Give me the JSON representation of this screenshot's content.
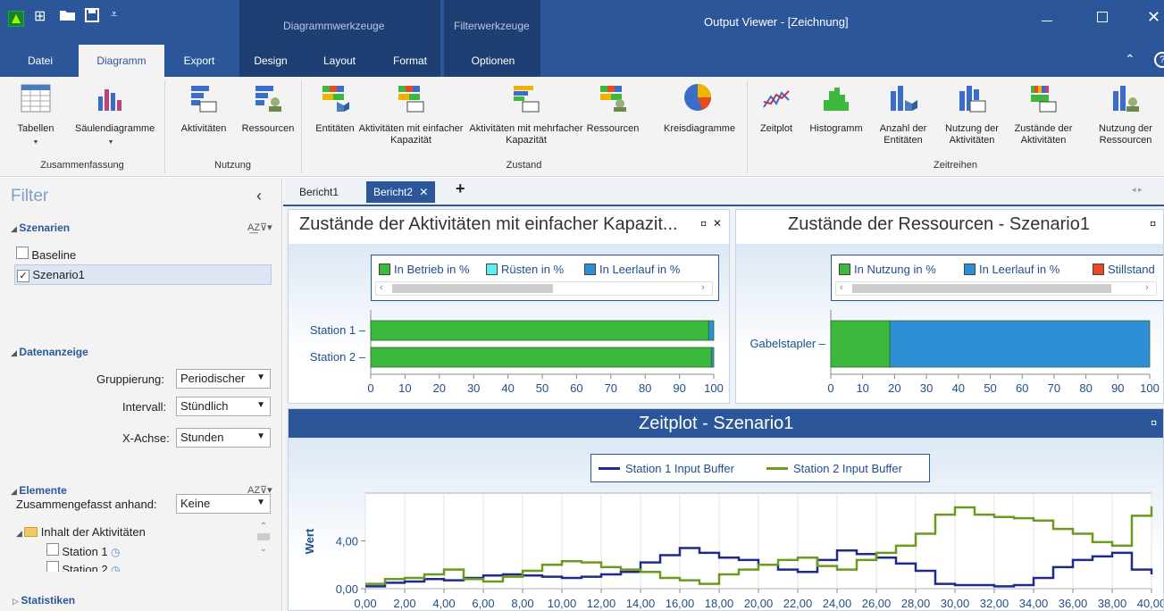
{
  "window": {
    "title": "Output Viewer - [Zeichnung]",
    "context_groups": [
      "Diagrammwerkzeuge",
      "Filterwerkzeuge"
    ]
  },
  "tabs": [
    "Datei",
    "Diagramm",
    "Export",
    "Design",
    "Layout",
    "Format",
    "Optionen"
  ],
  "ribbon": {
    "buttons": [
      {
        "label": "Tabellen",
        "dropdown": true
      },
      {
        "label": "Säulendiagramme",
        "dropdown": true
      },
      {
        "label": "Aktivitäten"
      },
      {
        "label": "Ressourcen"
      },
      {
        "label": "Entitäten"
      },
      {
        "label": "Aktivitäten mit einfacher Kapazität"
      },
      {
        "label": "Aktivitäten mit mehrfacher Kapazität"
      },
      {
        "label": "Ressourcen"
      },
      {
        "label": "Kreisdiagramme"
      },
      {
        "label": "Zeitplot"
      },
      {
        "label": "Histogramm"
      },
      {
        "label": "Anzahl der Entitäten"
      },
      {
        "label": "Nutzung der Aktivitäten"
      },
      {
        "label": "Zustände der Aktivitäten"
      },
      {
        "label": "Nutzung der Ressourcen"
      }
    ],
    "groups": [
      "Zusammenfassung",
      "Nutzung",
      "Zustand",
      "Zeitreihen"
    ]
  },
  "filter": {
    "title": "Filter",
    "collapse_glyph": "‹",
    "szenarien": {
      "label": "Szenarien",
      "items": [
        {
          "label": "Baseline",
          "checked": false
        },
        {
          "label": "Szenario1",
          "checked": true
        }
      ]
    },
    "datenanzeige": {
      "label": "Datenanzeige",
      "gruppierung_label": "Gruppierung:",
      "gruppierung_value": "Periodischer",
      "intervall_label": "Intervall:",
      "intervall_value": "Stündlich",
      "xachse_label": "X-Achse:",
      "xachse_value": "Stunden"
    },
    "elemente": {
      "label": "Elemente",
      "zusammengefasst_label": "Zusammengefasst anhand:",
      "zusammengefasst_value": "Keine",
      "folder": "Inhalt der Aktivitäten",
      "items": [
        "Station 1",
        "Station 2"
      ]
    },
    "statistiken": {
      "label": "Statistiken"
    }
  },
  "doc_tabs": [
    "Bericht1",
    "Bericht2"
  ],
  "doc_tab_add": "+",
  "panels": {
    "activities": {
      "title": "Zustände der Aktivitäten mit einfacher Kapazit...",
      "legend": [
        {
          "label": "In Betrieb in %",
          "color": "#3cb93c"
        },
        {
          "label": "Rüsten in %",
          "color": "#5ef0f0"
        },
        {
          "label": "In Leerlauf in %",
          "color": "#2e8fd6"
        }
      ]
    },
    "resources": {
      "title": "Zustände der Ressourcen - Szenario1",
      "legend": [
        {
          "label": "In Nutzung in %",
          "color": "#3cb93c"
        },
        {
          "label": "In Leerlauf in %",
          "color": "#2e8fd6"
        },
        {
          "label": "Stillstand",
          "color": "#e8491d"
        }
      ]
    },
    "zeitplot": {
      "title": "Zeitplot - Szenario1"
    }
  },
  "chart_data": [
    {
      "type": "bar",
      "orientation": "horizontal",
      "stacked": true,
      "categories": [
        "Station 1",
        "Station 2"
      ],
      "series": [
        {
          "name": "In Betrieb in %",
          "color": "#3cb93c",
          "values": [
            98.5,
            99.3
          ]
        },
        {
          "name": "Rüsten in %",
          "color": "#5ef0f0",
          "values": [
            0,
            0
          ]
        },
        {
          "name": "In Leerlauf in %",
          "color": "#2e8fd6",
          "values": [
            1.5,
            0.7
          ]
        }
      ],
      "xlim": [
        0,
        100
      ],
      "xticks": [
        0,
        10,
        20,
        30,
        40,
        50,
        60,
        70,
        80,
        90,
        100
      ],
      "grid": false
    },
    {
      "type": "bar",
      "orientation": "horizontal",
      "stacked": true,
      "categories": [
        "Gabelstapler"
      ],
      "series": [
        {
          "name": "In Nutzung in %",
          "color": "#3cb93c",
          "values": [
            18.5
          ]
        },
        {
          "name": "In Leerlauf in %",
          "color": "#2e8fd6",
          "values": [
            81.5
          ]
        },
        {
          "name": "Stillstand",
          "color": "#e8491d",
          "values": [
            0
          ]
        }
      ],
      "xlim": [
        0,
        100
      ],
      "xticks": [
        0,
        10,
        20,
        30,
        40,
        50,
        60,
        70,
        80,
        90,
        100
      ],
      "grid": false
    },
    {
      "type": "line",
      "step": true,
      "ylabel": "Wert",
      "xlim": [
        0,
        40
      ],
      "ylim": [
        0,
        8
      ],
      "xticks": [
        "0,00",
        "2,00",
        "4,00",
        "6,00",
        "8,00",
        "10,00",
        "12,00",
        "14,00",
        "16,00",
        "18,00",
        "20,00",
        "22,00",
        "24,00",
        "26,00",
        "28,00",
        "30,00",
        "32,00",
        "34,00",
        "36,00",
        "38,00",
        "40,00"
      ],
      "yticks": [
        "0,00",
        "4,00"
      ],
      "ytick_values": [
        0,
        4
      ],
      "x": [
        0,
        1,
        2,
        3,
        4,
        5,
        6,
        7,
        8,
        9,
        10,
        11,
        12,
        13,
        14,
        15,
        16,
        17,
        18,
        19,
        20,
        21,
        22,
        23,
        24,
        25,
        26,
        27,
        28,
        29,
        30,
        31,
        32,
        33,
        34,
        35,
        36,
        37,
        38,
        39,
        40
      ],
      "series": [
        {
          "name": "Station 1 Input Buffer",
          "color": "#1f2a8a",
          "values": [
            0.2,
            0.5,
            0.6,
            0.8,
            0.7,
            0.9,
            1.1,
            1.2,
            1.1,
            1.0,
            0.9,
            1.0,
            1.2,
            1.4,
            2.2,
            2.8,
            3.4,
            3.0,
            2.6,
            2.4,
            2.0,
            1.6,
            1.4,
            2.4,
            3.2,
            2.9,
            2.6,
            2.1,
            1.5,
            0.4,
            0.3,
            0.3,
            0.2,
            0.3,
            0.9,
            1.8,
            2.4,
            2.7,
            3.0,
            1.6,
            1.2
          ]
        },
        {
          "name": "Station 2 Input Buffer",
          "color": "#6c9a1f",
          "values": [
            0.4,
            0.8,
            0.9,
            1.2,
            1.6,
            0.8,
            0.6,
            1.0,
            1.5,
            2.0,
            2.3,
            2.2,
            1.8,
            1.6,
            1.4,
            0.9,
            0.7,
            0.4,
            1.2,
            1.6,
            2.0,
            2.4,
            2.6,
            1.9,
            1.6,
            2.4,
            3.0,
            3.6,
            4.6,
            6.2,
            6.8,
            6.2,
            6.0,
            5.9,
            5.7,
            5.0,
            4.6,
            3.9,
            3.6,
            6.1,
            6.9
          ]
        }
      ]
    }
  ]
}
